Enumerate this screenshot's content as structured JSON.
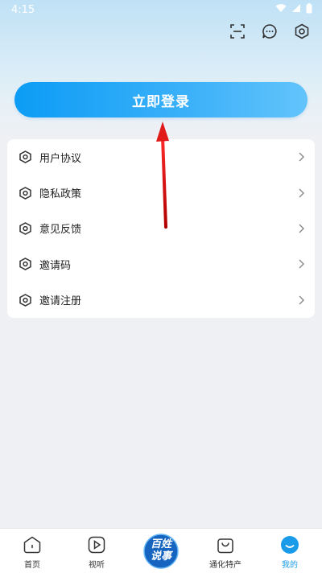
{
  "status_bar": {
    "time": "4:15"
  },
  "header": {
    "scan_icon": "scan-icon",
    "message_icon": "message-icon",
    "settings_icon": "settings-icon"
  },
  "login_button": {
    "label": "立即登录"
  },
  "menu": {
    "items": [
      {
        "label": "用户协议",
        "icon": "hexagon-icon"
      },
      {
        "label": "隐私政策",
        "icon": "hexagon-icon"
      },
      {
        "label": "意见反馈",
        "icon": "hexagon-icon"
      },
      {
        "label": "邀请码",
        "icon": "hexagon-icon"
      },
      {
        "label": "邀请注册",
        "icon": "hexagon-icon"
      }
    ]
  },
  "bottom_nav": {
    "items": [
      {
        "label": "首页",
        "icon": "home-icon"
      },
      {
        "label": "视听",
        "icon": "play-icon"
      },
      {
        "label": "",
        "icon": "center-logo"
      },
      {
        "label": "通化特产",
        "icon": "shopping-bag-icon"
      },
      {
        "label": "我的",
        "icon": "profile-icon",
        "active": true
      }
    ],
    "center_logo_text": [
      "百姓",
      "说事"
    ]
  },
  "colors": {
    "accent": "#1a9bea",
    "login_gradient_start": "#0c9cf5",
    "login_gradient_end": "#63c4fb",
    "annotation_arrow": "#e01919",
    "logo_blue": "#1565c0"
  }
}
